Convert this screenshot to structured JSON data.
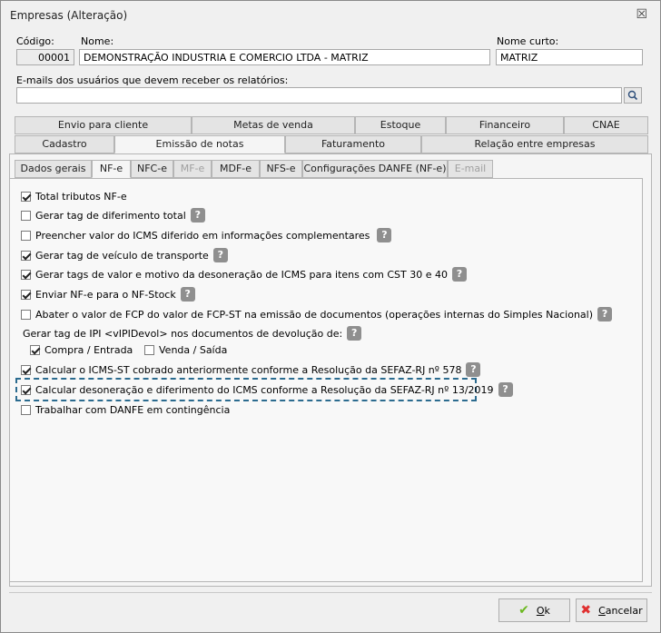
{
  "window": {
    "title": "Empresas (Alteração)",
    "close_glyph": "☒"
  },
  "header": {
    "codigo_label": "Código:",
    "codigo_value": "00001",
    "nome_label": "Nome:",
    "nome_value": "DEMONSTRAÇÃO INDUSTRIA E COMERCIO LTDA - MATRIZ",
    "nome_curto_label": "Nome curto:",
    "nome_curto_value": "MATRIZ",
    "emails_label": "E-mails dos usuários que devem receber os relatórios:",
    "emails_value": ""
  },
  "tabs_row1": [
    "Envio para cliente",
    "Metas de venda",
    "Estoque",
    "Financeiro",
    "CNAE"
  ],
  "tabs_row2": [
    "Cadastro",
    "Emissão de notas",
    "Faturamento",
    "Relação entre empresas"
  ],
  "subtabs": [
    "Dados gerais",
    "NF-e",
    "NFC-e",
    "MF-e",
    "MDF-e",
    "NFS-e",
    "Configurações DANFE (NF-e)",
    "E-mail"
  ],
  "options": {
    "o1": "Total tributos NF-e",
    "o2": "Gerar tag de diferimento total",
    "o3": "Preencher valor do ICMS diferido em informações complementares",
    "o4": "Gerar tag de veículo de transporte",
    "o5": "Gerar tags de valor e motivo da desoneração de ICMS para itens com CST 30 e 40",
    "o6": "Enviar NF-e para o NF-Stock",
    "o7": "Abater o valor de FCP do valor de FCP-ST na emissão de documentos (operações internas do Simples Nacional)",
    "ipi_label": "Gerar tag de IPI <vIPIDevol> nos documentos de devolução de:",
    "ipi_compra": "Compra / Entrada",
    "ipi_venda": "Venda / Saída",
    "o8": "Calcular o ICMS-ST cobrado anteriormente conforme a Resolução da SEFAZ-RJ nº 578",
    "o9": "Calcular desoneração e diferimento do ICMS conforme a Resolução da SEFAZ-RJ nº 13/2019",
    "o10": "Trabalhar com DANFE em contingência"
  },
  "help_glyph": "?",
  "buttons": {
    "ok_u": "O",
    "ok_rest": "k",
    "cancel_u": "C",
    "cancel_rest": "ancelar",
    "ok_icon": "✔",
    "cancel_icon": "✖"
  },
  "colors": {
    "ok_icon": "#6bb820",
    "cancel_icon": "#e03030",
    "focus": "#2b6b8f"
  }
}
